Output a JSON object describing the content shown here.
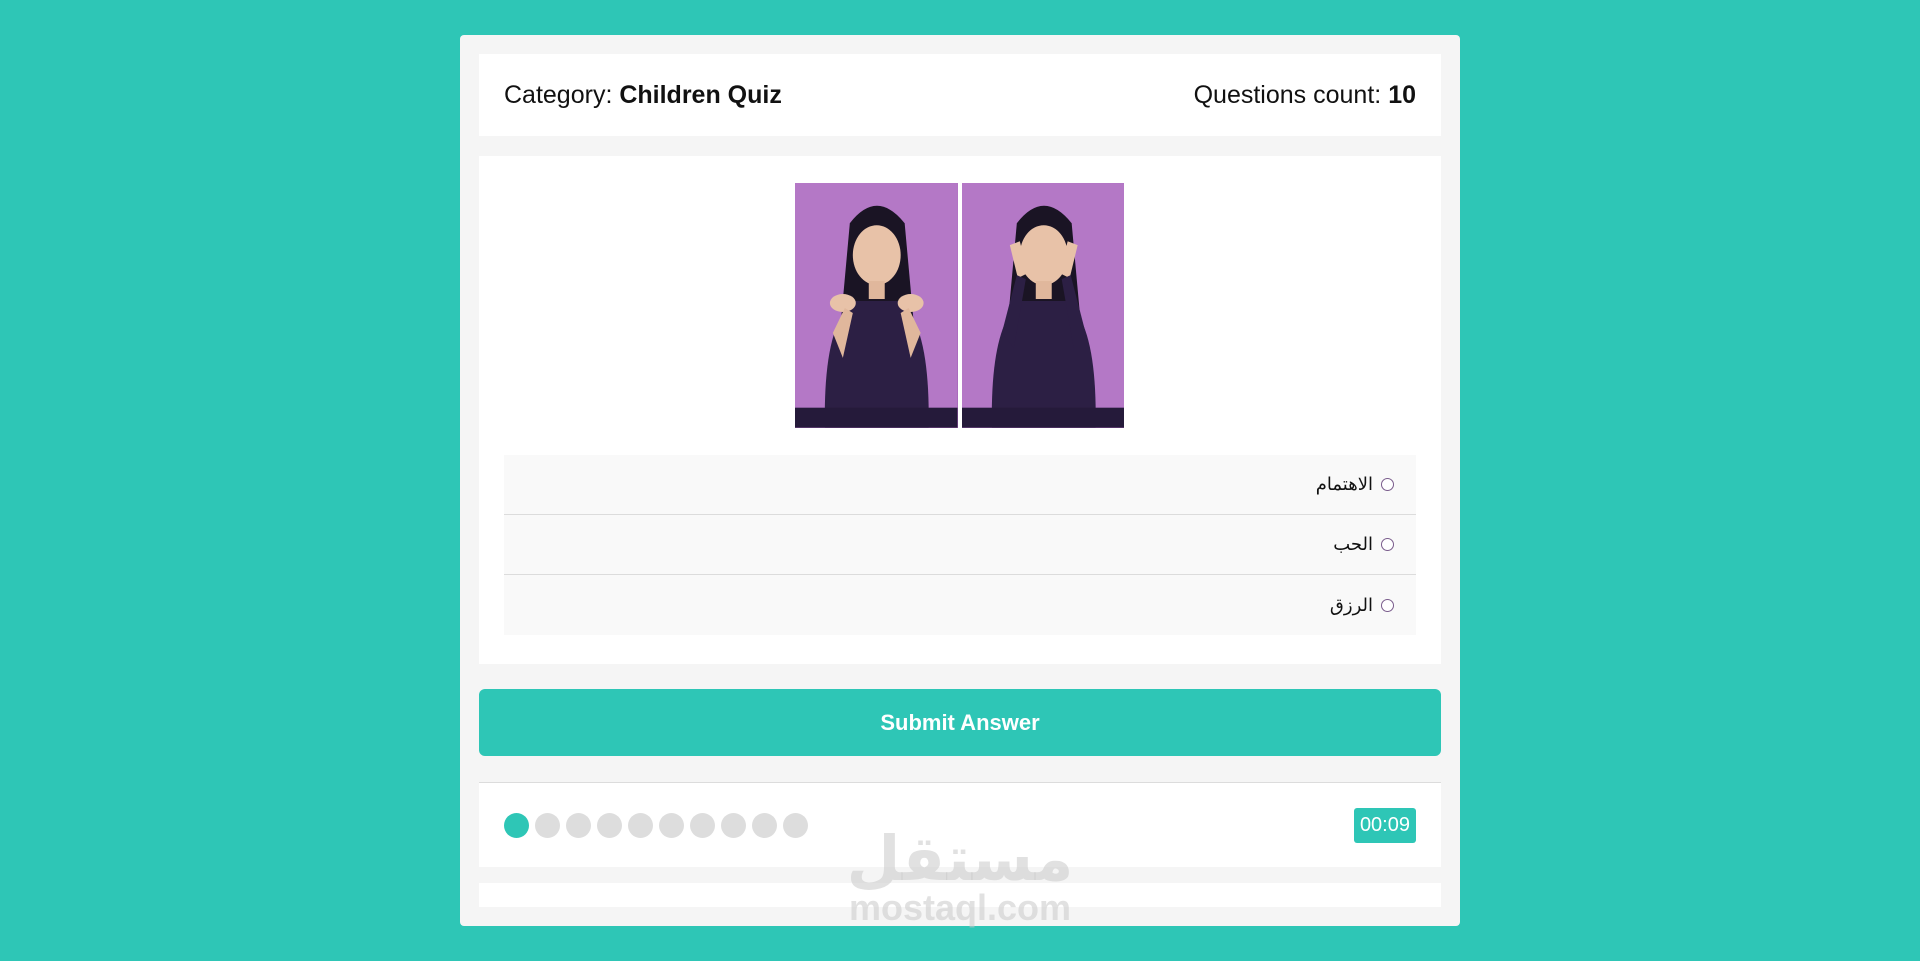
{
  "quiz_info": {
    "category_label": "Category:",
    "category_value": "Children Quiz",
    "count_label": "Questions count:",
    "count_value": "10"
  },
  "question": {
    "image_count": 2,
    "answers": [
      {
        "label": "الاهتمام",
        "selected": false
      },
      {
        "label": "الحب",
        "selected": false
      },
      {
        "label": "الرزق",
        "selected": false
      }
    ]
  },
  "submit_label": "Submit Answer",
  "progress": {
    "total": 10,
    "current": 1
  },
  "countdown": "00:09",
  "watermark": {
    "logo": "مستقل",
    "url": "mostaql.com"
  },
  "colors": {
    "background": "#2ec6b6",
    "accent": "#2ec6b6",
    "bullet_inactive": "#dddddd",
    "panel": "#ffffff"
  }
}
